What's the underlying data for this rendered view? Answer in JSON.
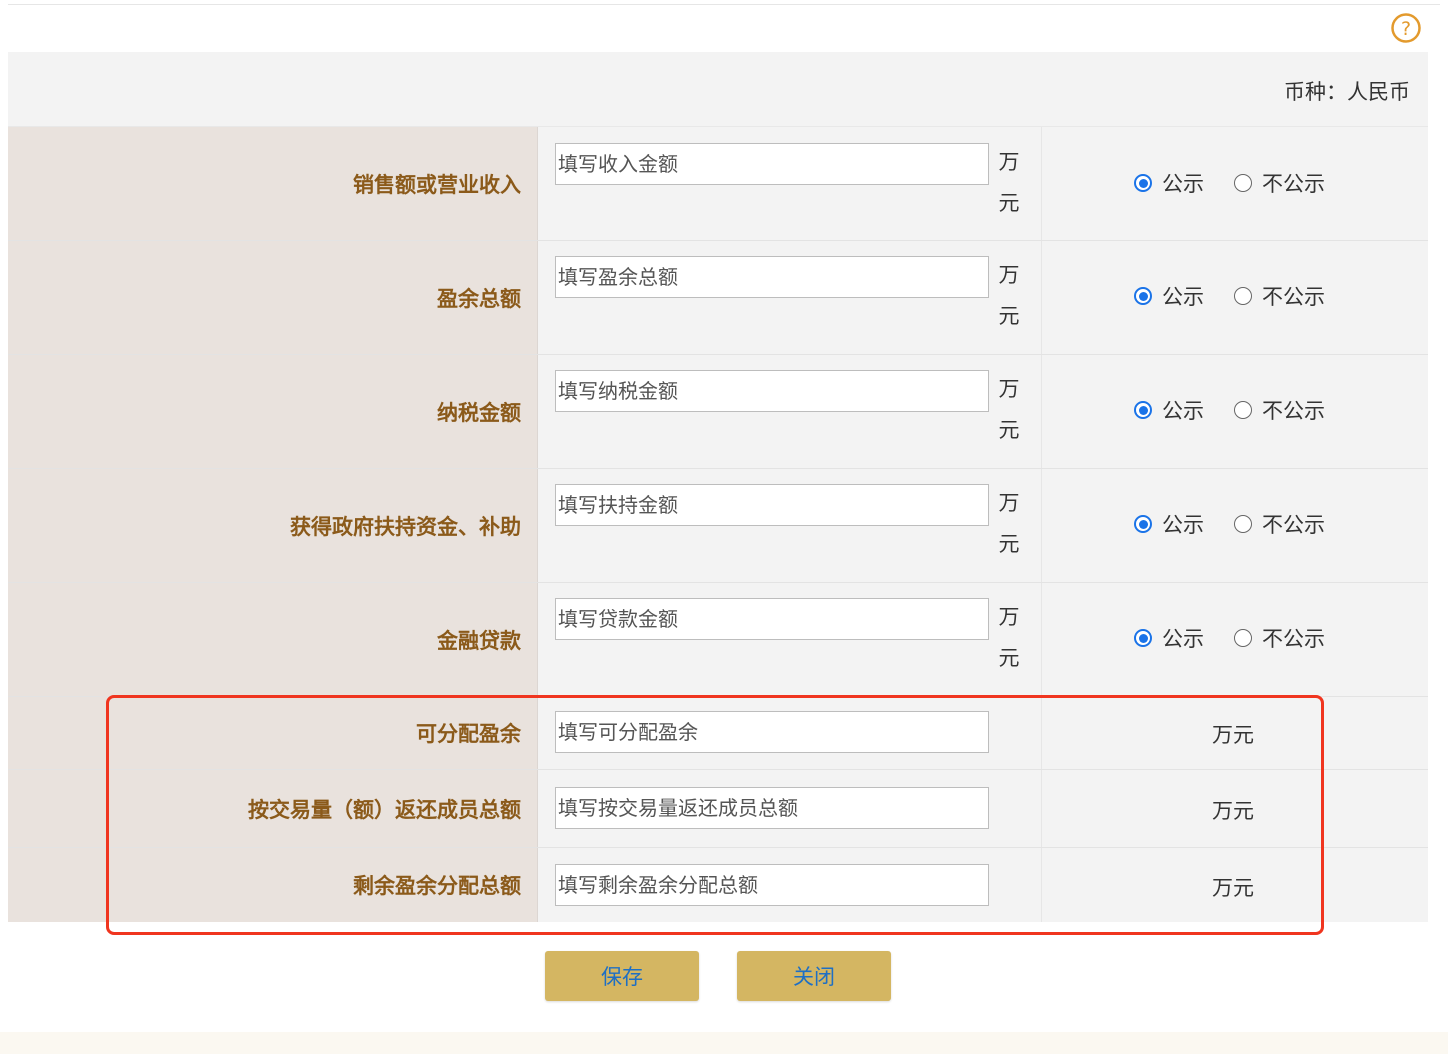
{
  "currency_label": "币种：人民币",
  "rows": [
    {
      "label": "销售额或营业收入",
      "placeholder": "填写收入金额",
      "unit_line1": "万",
      "unit_line2": "元",
      "option_publish": "公示",
      "option_private": "不公示",
      "selected": "公示"
    },
    {
      "label": "盈余总额",
      "placeholder": "填写盈余总额",
      "unit_line1": "万",
      "unit_line2": "元",
      "option_publish": "公示",
      "option_private": "不公示",
      "selected": "公示"
    },
    {
      "label": "纳税金额",
      "placeholder": "填写纳税金额",
      "unit_line1": "万",
      "unit_line2": "元",
      "option_publish": "公示",
      "option_private": "不公示",
      "selected": "公示"
    },
    {
      "label": "获得政府扶持资金、补助",
      "placeholder": "填写扶持金额",
      "unit_line1": "万",
      "unit_line2": "元",
      "option_publish": "公示",
      "option_private": "不公示",
      "selected": "公示"
    },
    {
      "label": "金融贷款",
      "placeholder": "填写贷款金额",
      "unit_line1": "万",
      "unit_line2": "元",
      "option_publish": "公示",
      "option_private": "不公示",
      "selected": "公示"
    }
  ],
  "rows_plain": [
    {
      "label": "可分配盈余",
      "placeholder": "填写可分配盈余",
      "unit": "万元"
    },
    {
      "label": "按交易量（额）返还成员总额",
      "placeholder": "填写按交易量返还成员总额",
      "unit": "万元"
    },
    {
      "label": "剩余盈余分配总额",
      "placeholder": "填写剩余盈余分配总额",
      "unit": "万元"
    }
  ],
  "buttons": {
    "save": "保存",
    "close": "关闭"
  },
  "colors": {
    "label_text": "#8b5a1a",
    "label_bg": "#e9e2dd",
    "button_bg": "#d4b662",
    "button_text": "#1e6fc4",
    "highlight": "#f0351f",
    "radio_selected": "#1a73e8"
  }
}
